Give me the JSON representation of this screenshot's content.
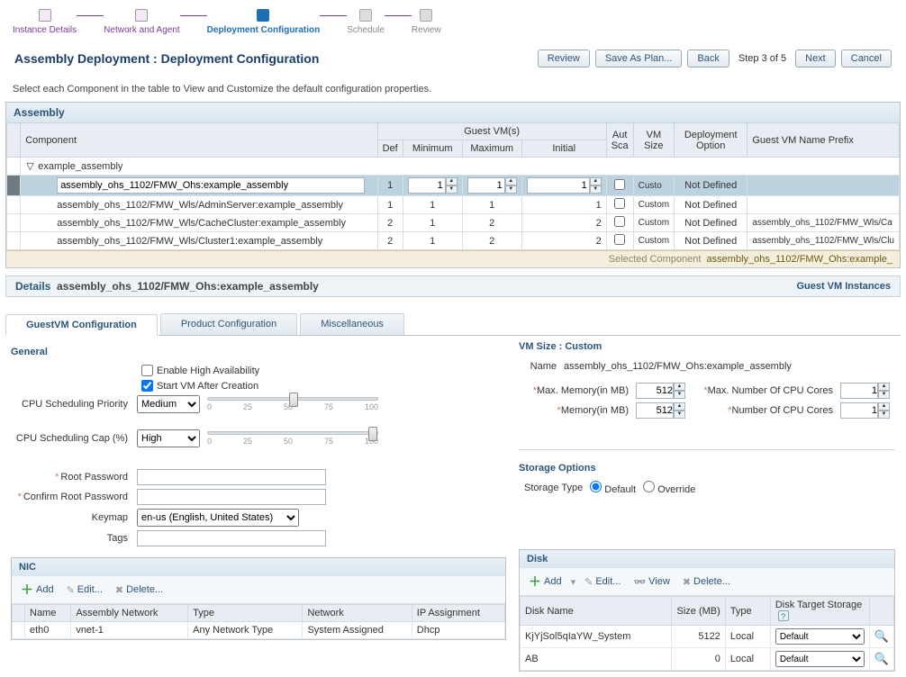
{
  "wizard": {
    "steps": [
      {
        "label": "Instance Details",
        "state": "done"
      },
      {
        "label": "Network and Agent",
        "state": "done"
      },
      {
        "label": "Deployment Configuration",
        "state": "current"
      },
      {
        "label": "Schedule",
        "state": "pending"
      },
      {
        "label": "Review",
        "state": "pending"
      }
    ]
  },
  "header": {
    "title": "Assembly Deployment : Deployment Configuration",
    "buttons": {
      "review": "Review",
      "save_as_plan": "Save As Plan...",
      "back": "Back",
      "next": "Next",
      "cancel": "Cancel"
    },
    "step_text": "Step 3 of 5"
  },
  "instruction": "Select each Component in the table to View and Customize the default configuration properties.",
  "assembly": {
    "title": "Assembly",
    "columns": {
      "component": "Component",
      "group_guest_vms": "Guest VM(s)",
      "def": "Def",
      "minimum": "Minimum",
      "maximum": "Maximum",
      "initial": "Initial",
      "auto_sca": "Aut Sca",
      "vm_size": "VM Size",
      "deployment_option": "Deployment Option",
      "prefix": "Guest VM Name Prefix"
    },
    "tree_root": "example_assembly",
    "rows": [
      {
        "name": "assembly_ohs_1102/FMW_Ohs:example_assembly",
        "def": 1,
        "min": 1,
        "max": 1,
        "initial": 1,
        "size": "Custo",
        "deploy": "Not Defined",
        "prefix": "",
        "selected": true,
        "editable": true
      },
      {
        "name": "assembly_ohs_1102/FMW_Wls/AdminServer:example_assembly",
        "def": 1,
        "min": 1,
        "max": 1,
        "initial": 1,
        "size": "Custom",
        "deploy": "Not Defined",
        "prefix": ""
      },
      {
        "name": "assembly_ohs_1102/FMW_Wls/CacheCluster:example_assembly",
        "def": 2,
        "min": 1,
        "max": 2,
        "initial": 2,
        "size": "Custom",
        "deploy": "Not Defined",
        "prefix": "assembly_ohs_1102/FMW_Wls/Ca"
      },
      {
        "name": "assembly_ohs_1102/FMW_Wls/Cluster1:example_assembly",
        "def": 2,
        "min": 1,
        "max": 2,
        "initial": 2,
        "size": "Custom",
        "deploy": "Not Defined",
        "prefix": "assembly_ohs_1102/FMW_Wls/Clu"
      }
    ],
    "selected_footer_label": "Selected Component",
    "selected_footer_value": "assembly_ohs_1102/FMW_Ohs:example_"
  },
  "details": {
    "label": "Details",
    "component": "assembly_ohs_1102/FMW_Ohs:example_assembly",
    "link": "Guest VM Instances"
  },
  "tabs": {
    "guestvm": "GuestVM Configuration",
    "product": "Product Configuration",
    "misc": "Miscellaneous"
  },
  "general": {
    "title": "General",
    "enable_ha": "Enable High Availability",
    "start_vm": "Start VM After Creation",
    "start_vm_checked": true,
    "priority_label": "CPU Scheduling Priority",
    "priority_value": "Medium",
    "cap_label": "CPU Scheduling Cap (%)",
    "cap_value": "High",
    "root_pw": "Root Password",
    "confirm_pw": "Confirm Root Password",
    "keymap_label": "Keymap",
    "keymap_value": "en-us (English, United States)",
    "tags_label": "Tags",
    "slider_ticks": [
      "0",
      "25",
      "50",
      "75",
      "100"
    ]
  },
  "vmsize": {
    "title": "VM Size : Custom",
    "name_label": "Name",
    "name_value": "assembly_ohs_1102/FMW_Ohs:example_assembly",
    "max_mem_label": "Max. Memory(in MB)",
    "max_mem": 512,
    "mem_label": "Memory(in MB)",
    "mem": 512,
    "max_cores_label": "Max. Number Of CPU Cores",
    "max_cores": 1,
    "cores_label": "Number Of CPU Cores",
    "cores": 1
  },
  "storage": {
    "title": "Storage Options",
    "type_label": "Storage Type",
    "default": "Default",
    "override": "Override",
    "selected": "default"
  },
  "nic": {
    "title": "NIC",
    "add": "Add",
    "edit": "Edit...",
    "del": "Delete...",
    "cols": {
      "name": "Name",
      "anet": "Assembly Network",
      "type": "Type",
      "network": "Network",
      "ip": "IP Assignment"
    },
    "rows": [
      {
        "name": "eth0",
        "anet": "vnet-1",
        "type": "Any Network Type",
        "network": "System Assigned",
        "ip": "Dhcp"
      }
    ]
  },
  "disk": {
    "title": "Disk",
    "add": "Add",
    "edit": "Edit...",
    "view": "View",
    "del": "Delete...",
    "cols": {
      "name": "Disk Name",
      "size": "Size (MB)",
      "type": "Type",
      "target": "Disk Target Storage"
    },
    "target_default": "Default",
    "rows": [
      {
        "name": "KjYjSol5qIaYW_System",
        "size": 5122,
        "type": "Local"
      },
      {
        "name": "AB",
        "size": 0,
        "type": "Local"
      }
    ]
  }
}
